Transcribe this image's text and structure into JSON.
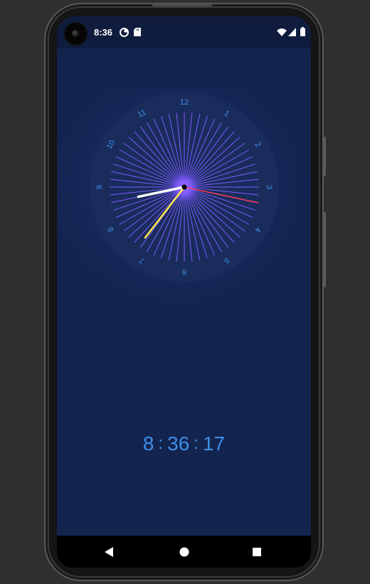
{
  "status_bar": {
    "time": "8:36",
    "icons": [
      "camera-icon",
      "data-saver-icon",
      "sd-card-icon",
      "wifi-icon",
      "signal-icon",
      "battery-icon"
    ]
  },
  "clock": {
    "numbers": [
      "12",
      "1",
      "2",
      "3",
      "4",
      "5",
      "6",
      "7",
      "8",
      "9",
      "10",
      "11"
    ],
    "colors": {
      "face": "#1a2c5c",
      "ticks": "#7b5cff",
      "numbers": "#3d8fe6",
      "hour_hand": "#ffffff",
      "minute_hand": "#ffe94a",
      "second_hand": "#ff3b5c",
      "center": "#000000"
    }
  },
  "digital_time": {
    "hours": "8",
    "minutes": "36",
    "seconds": "17",
    "separator": ":"
  },
  "nav_bar": {
    "icons": [
      "back-icon",
      "home-icon",
      "recents-icon"
    ]
  },
  "colors": {
    "background": "#13244f",
    "status_bar": "#101c3d",
    "digital_text": "#3d8fe6"
  }
}
